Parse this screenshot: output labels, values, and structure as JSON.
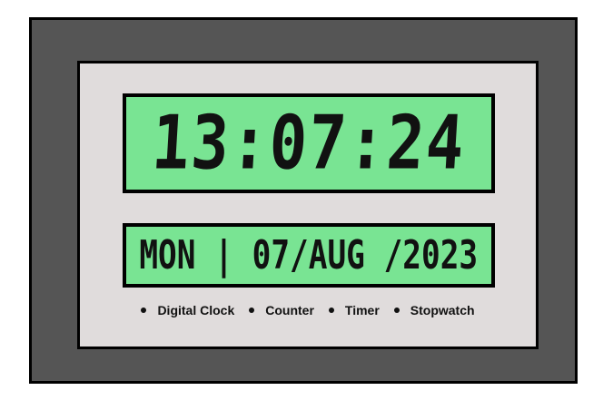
{
  "clock": {
    "time": "13:07:24",
    "date": "MON | 07/AUG /2023"
  },
  "nav": {
    "items": [
      {
        "label": "Digital Clock"
      },
      {
        "label": "Counter"
      },
      {
        "label": "Timer"
      },
      {
        "label": "Stopwatch"
      }
    ]
  },
  "colors": {
    "outer_frame": "#555555",
    "panel": "#e0dcdc",
    "lcd": "#79e493",
    "digits": "#111111"
  }
}
